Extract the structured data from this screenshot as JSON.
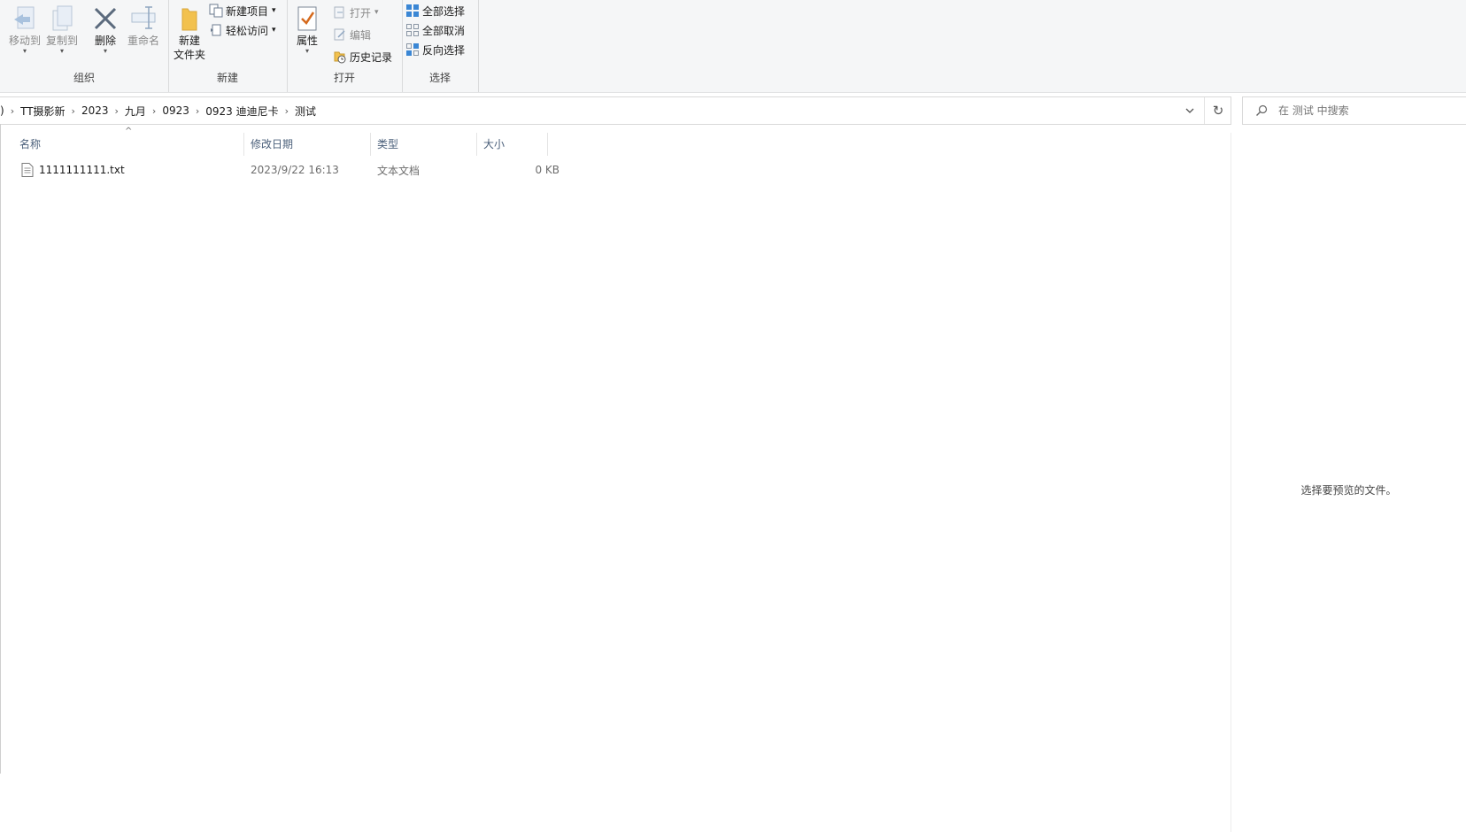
{
  "ribbon": {
    "organize": {
      "label": "组织",
      "move_to": "移动到",
      "copy_to": "复制到",
      "delete": "删除",
      "rename": "重命名"
    },
    "new": {
      "label": "新建",
      "new_folder_line1": "新建",
      "new_folder_line2": "文件夹",
      "new_item": "新建项目",
      "easy_access": "轻松访问"
    },
    "open": {
      "label": "打开",
      "properties": "属性",
      "open": "打开",
      "edit": "编辑",
      "history": "历史记录"
    },
    "select": {
      "label": "选择",
      "select_all": "全部选择",
      "select_none": "全部取消",
      "invert": "反向选择"
    }
  },
  "address": {
    "leading": ")",
    "crumbs": [
      "TT摄影新",
      "2023",
      "九月",
      "0923",
      "0923 迪迪尼卡",
      "测试"
    ]
  },
  "search": {
    "placeholder": "在 测试 中搜索"
  },
  "columns": {
    "name": "名称",
    "modified": "修改日期",
    "type": "类型",
    "size": "大小"
  },
  "files": [
    {
      "name": "1111111111.txt",
      "modified": "2023/9/22 16:13",
      "type": "文本文档",
      "size": "0 KB"
    }
  ],
  "preview": {
    "message": "选择要预览的文件。"
  },
  "colors": {
    "accent": "#1e73c8",
    "folder": "#f2c14e",
    "header_text": "#4a5f7a"
  }
}
